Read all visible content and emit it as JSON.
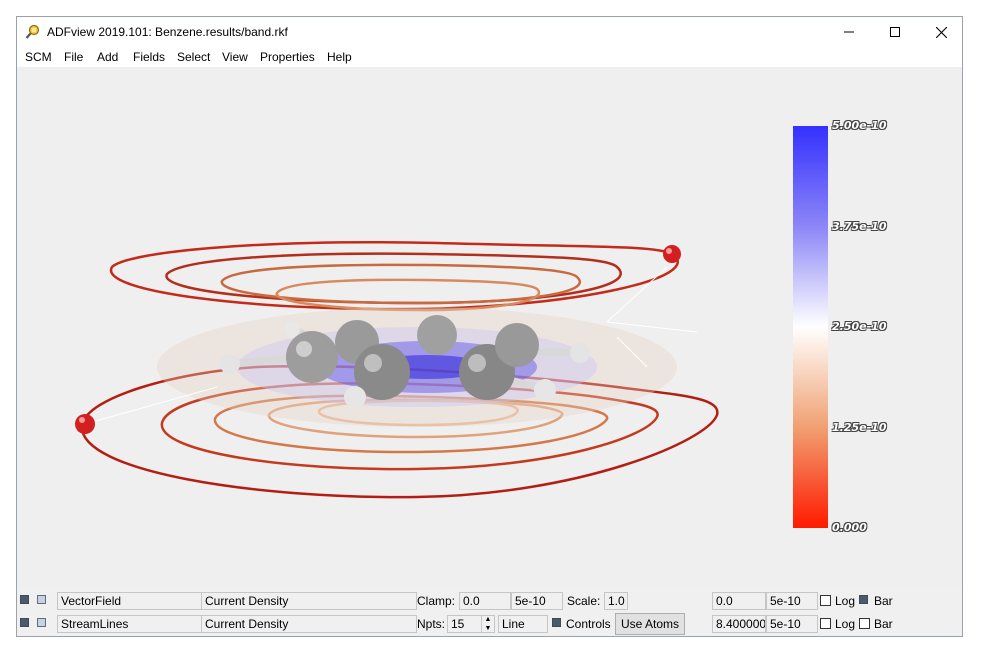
{
  "window": {
    "title": "ADFview 2019.101: Benzene.results/band.rkf"
  },
  "menu": {
    "items": [
      "SCM",
      "File",
      "Add",
      "Fields",
      "Select",
      "View",
      "Properties",
      "Help"
    ]
  },
  "colorbar": {
    "labels": [
      "5.00e-10",
      "3.75e-10",
      "2.50e-10",
      "1.25e-10",
      "0.000"
    ],
    "top_color": "#3431ff",
    "mid_color": "#ffffff",
    "bottom_color": "#ff1a00"
  },
  "rows": [
    {
      "type": "VectorField",
      "field": "Current Density",
      "param1_label": "Clamp:",
      "param1_value": "0.0",
      "param2_value": "5e-10",
      "param3_label": "Scale:",
      "param3_value": "1.0",
      "min": "0.0",
      "max": "5e-10",
      "log_label": "Log",
      "bar_label": "Bar"
    },
    {
      "type": "StreamLines",
      "field": "Current Density",
      "param1_label": "Npts:",
      "param1_value": "15",
      "param2_value": "Line",
      "controls_label": "Controls",
      "use_atoms_label": "Use Atoms",
      "min": "8.400000",
      "max": "5e-10",
      "log_label": "Log",
      "bar_label": "Bar"
    }
  ]
}
